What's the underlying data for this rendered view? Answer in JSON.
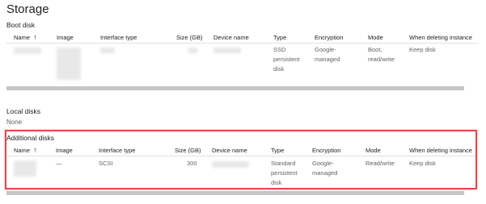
{
  "page": {
    "title": "Storage"
  },
  "boot_disk": {
    "label": "Boot disk",
    "columns": [
      "Name",
      "Image",
      "Interface type",
      "Size (GB)",
      "Device name",
      "Type",
      "Encryption",
      "Mode",
      "When deleting instance"
    ],
    "row": {
      "type_lines": [
        "SSD",
        "persistent",
        "disk"
      ],
      "encryption_lines": [
        "Google-",
        "managed"
      ],
      "mode_lines": [
        "Boot,",
        "read/write"
      ],
      "when_deleting": "Keep disk"
    }
  },
  "local_disks": {
    "label": "Local disks",
    "value": "None"
  },
  "additional_disks": {
    "label": "Additional disks",
    "columns": [
      "Name",
      "Image",
      "Interface type",
      "Size (GB)",
      "Device name",
      "Type",
      "Encryption",
      "Mode",
      "When deleting instance"
    ],
    "row": {
      "image": "—",
      "interface_type": "SCSI",
      "size_gb": "300",
      "type_lines": [
        "Standard",
        "persistent",
        "disk"
      ],
      "encryption_lines": [
        "Google-",
        "managed"
      ],
      "mode": "Read/write",
      "when_deleting": "Keep disk"
    }
  },
  "icons": {
    "sort": "arrow-up-icon"
  },
  "colors": {
    "highlight": "#e5484d"
  }
}
